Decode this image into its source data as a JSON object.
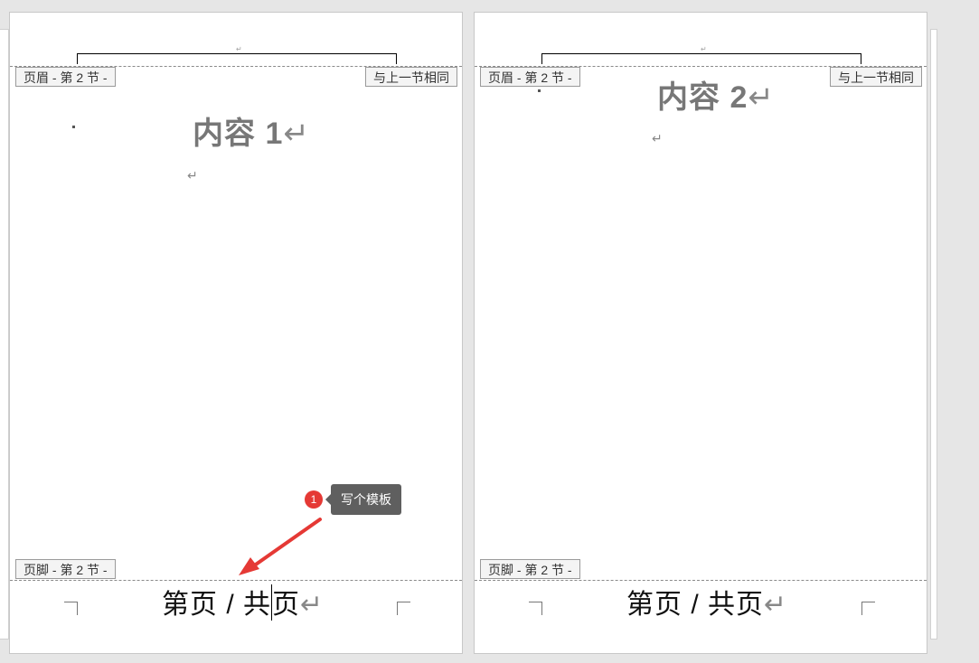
{
  "pages": [
    {
      "header_tag": "页眉 - 第 2 节 -",
      "same_as_prev": "与上一节相同",
      "small_mark": "↵",
      "heading_text": "内容 1",
      "return_mark": "↵",
      "para_mark": "↵",
      "footer_tag": "页脚 - 第 2 节 -",
      "footer_before_caret": "第页 / 共",
      "footer_after_caret": "页",
      "footer_return": "↵"
    },
    {
      "header_tag": "页眉 - 第 2 节 -",
      "same_as_prev": "与上一节相同",
      "small_mark": "↵",
      "heading_text": "内容 2",
      "return_mark": "↵",
      "para_mark": "↵",
      "footer_tag": "页脚 - 第 2 节 -",
      "footer_text": "第页 / 共页",
      "footer_return": "↵"
    }
  ],
  "callout": {
    "number": "1",
    "label": "写个模板",
    "color": "#e53935"
  }
}
